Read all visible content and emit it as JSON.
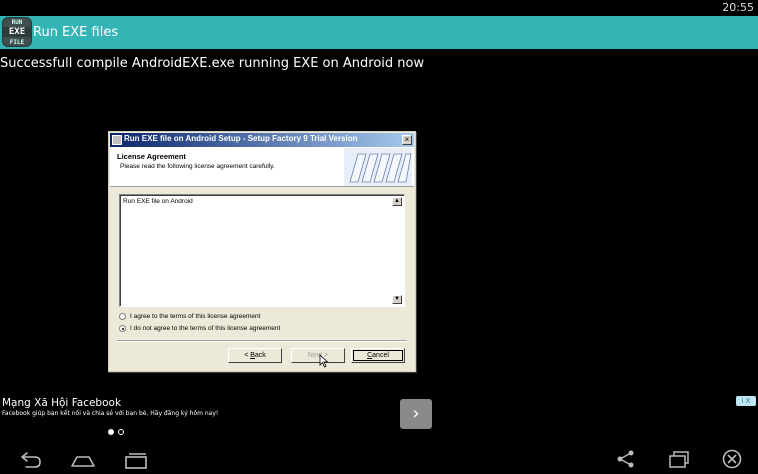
{
  "status_bar": {
    "time": "20:55"
  },
  "app": {
    "icon": {
      "line1": "RUN",
      "line2": "EXE",
      "line3": "FILE"
    },
    "title": "Run EXE files"
  },
  "message": "Successfull compile AndroidEXE.exe running EXE on Android now",
  "installer": {
    "window_title": "Run EXE file on Android Setup - Setup Factory 9 Trial Version",
    "header_title": "License Agreement",
    "header_subtitle": "Please read the following license agreement carefully.",
    "license_text": "Run EXE file on Android",
    "options": [
      {
        "label": "I agree to the terms of this license agreement",
        "selected": false
      },
      {
        "label": "I do not agree to the terms of this license agreement",
        "selected": true
      }
    ],
    "buttons": {
      "back_prefix": "< ",
      "back_key": "B",
      "back_rest": "ack",
      "next": "Next >",
      "cancel_key": "C",
      "cancel_rest": "ancel"
    }
  },
  "ad": {
    "title": "Mạng Xã Hội Facebook",
    "description": "Facebook giúp bạn kết nối và chia sẻ với bạn bè. Hãy đăng ký hôm nay!",
    "page_dots": [
      true,
      false
    ],
    "next_icon": "chevron-right-icon",
    "choices_label": "i X"
  },
  "navbar": {
    "icons": [
      "back-icon",
      "home-icon",
      "recent-apps-icon",
      "share-icon",
      "window-icon",
      "close-circle-icon"
    ]
  }
}
